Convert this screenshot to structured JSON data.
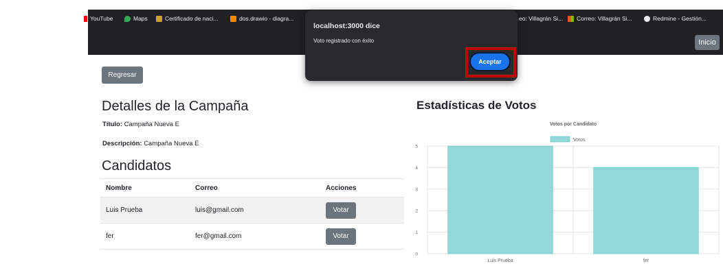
{
  "bookmarks": [
    {
      "label": "YouTube",
      "icon": "youtube-icon",
      "color": "#ff0000"
    },
    {
      "label": "Maps",
      "icon": "maps-icon",
      "color": "#34a853"
    },
    {
      "label": "Certificado de naci...",
      "icon": "folder-icon",
      "color": "#c9a227"
    },
    {
      "label": "dos.drawio - diagra...",
      "icon": "drawio-icon",
      "color": "#f08705"
    },
    {
      "label": "eo: Villagrán Si...",
      "icon": "mail-icon",
      "color": "#202124"
    },
    {
      "label": "Correo: Villagrán Si...",
      "icon": "microsoft-icon",
      "color": "#f25022"
    },
    {
      "label": "Redmine - Gestión...",
      "icon": "globe-icon",
      "color": "#e8eaed"
    }
  ],
  "nav": {
    "inicio": "Inicio"
  },
  "dialog": {
    "title": "localhost:3000 dice",
    "message": "Voto registrado con éxito",
    "accept": "Aceptar"
  },
  "page": {
    "back": "Regresar",
    "details_heading": "Detalles de la Campaña",
    "title_label": "Título:",
    "title_value": "Campaña Nueva E",
    "desc_label": "Descripción:",
    "desc_value": "Campaña Nueva E",
    "candidates_heading": "Candidatos",
    "columns": [
      "Nombre",
      "Correo",
      "Acciones"
    ],
    "rows": [
      {
        "name": "Luis Prueba",
        "email": "luis@gmail.com",
        "action": "Votar"
      },
      {
        "name": "fer",
        "email": "fer@gmail.com",
        "action": "Votar"
      }
    ],
    "stats_heading": "Estadísticas de Votos"
  },
  "chart_data": {
    "type": "bar",
    "title": "Votos por Candidato",
    "categories": [
      "Luis Prueba",
      "fer"
    ],
    "series": [
      {
        "name": "Votos",
        "values": [
          5,
          4
        ]
      }
    ],
    "ylim": [
      0,
      5
    ],
    "yticks": [
      "0",
      "1",
      "2",
      "3",
      "4",
      "5"
    ],
    "grid": true,
    "legend": "top",
    "color": "#93d8d8",
    "border_color": "#4bc0c0"
  }
}
